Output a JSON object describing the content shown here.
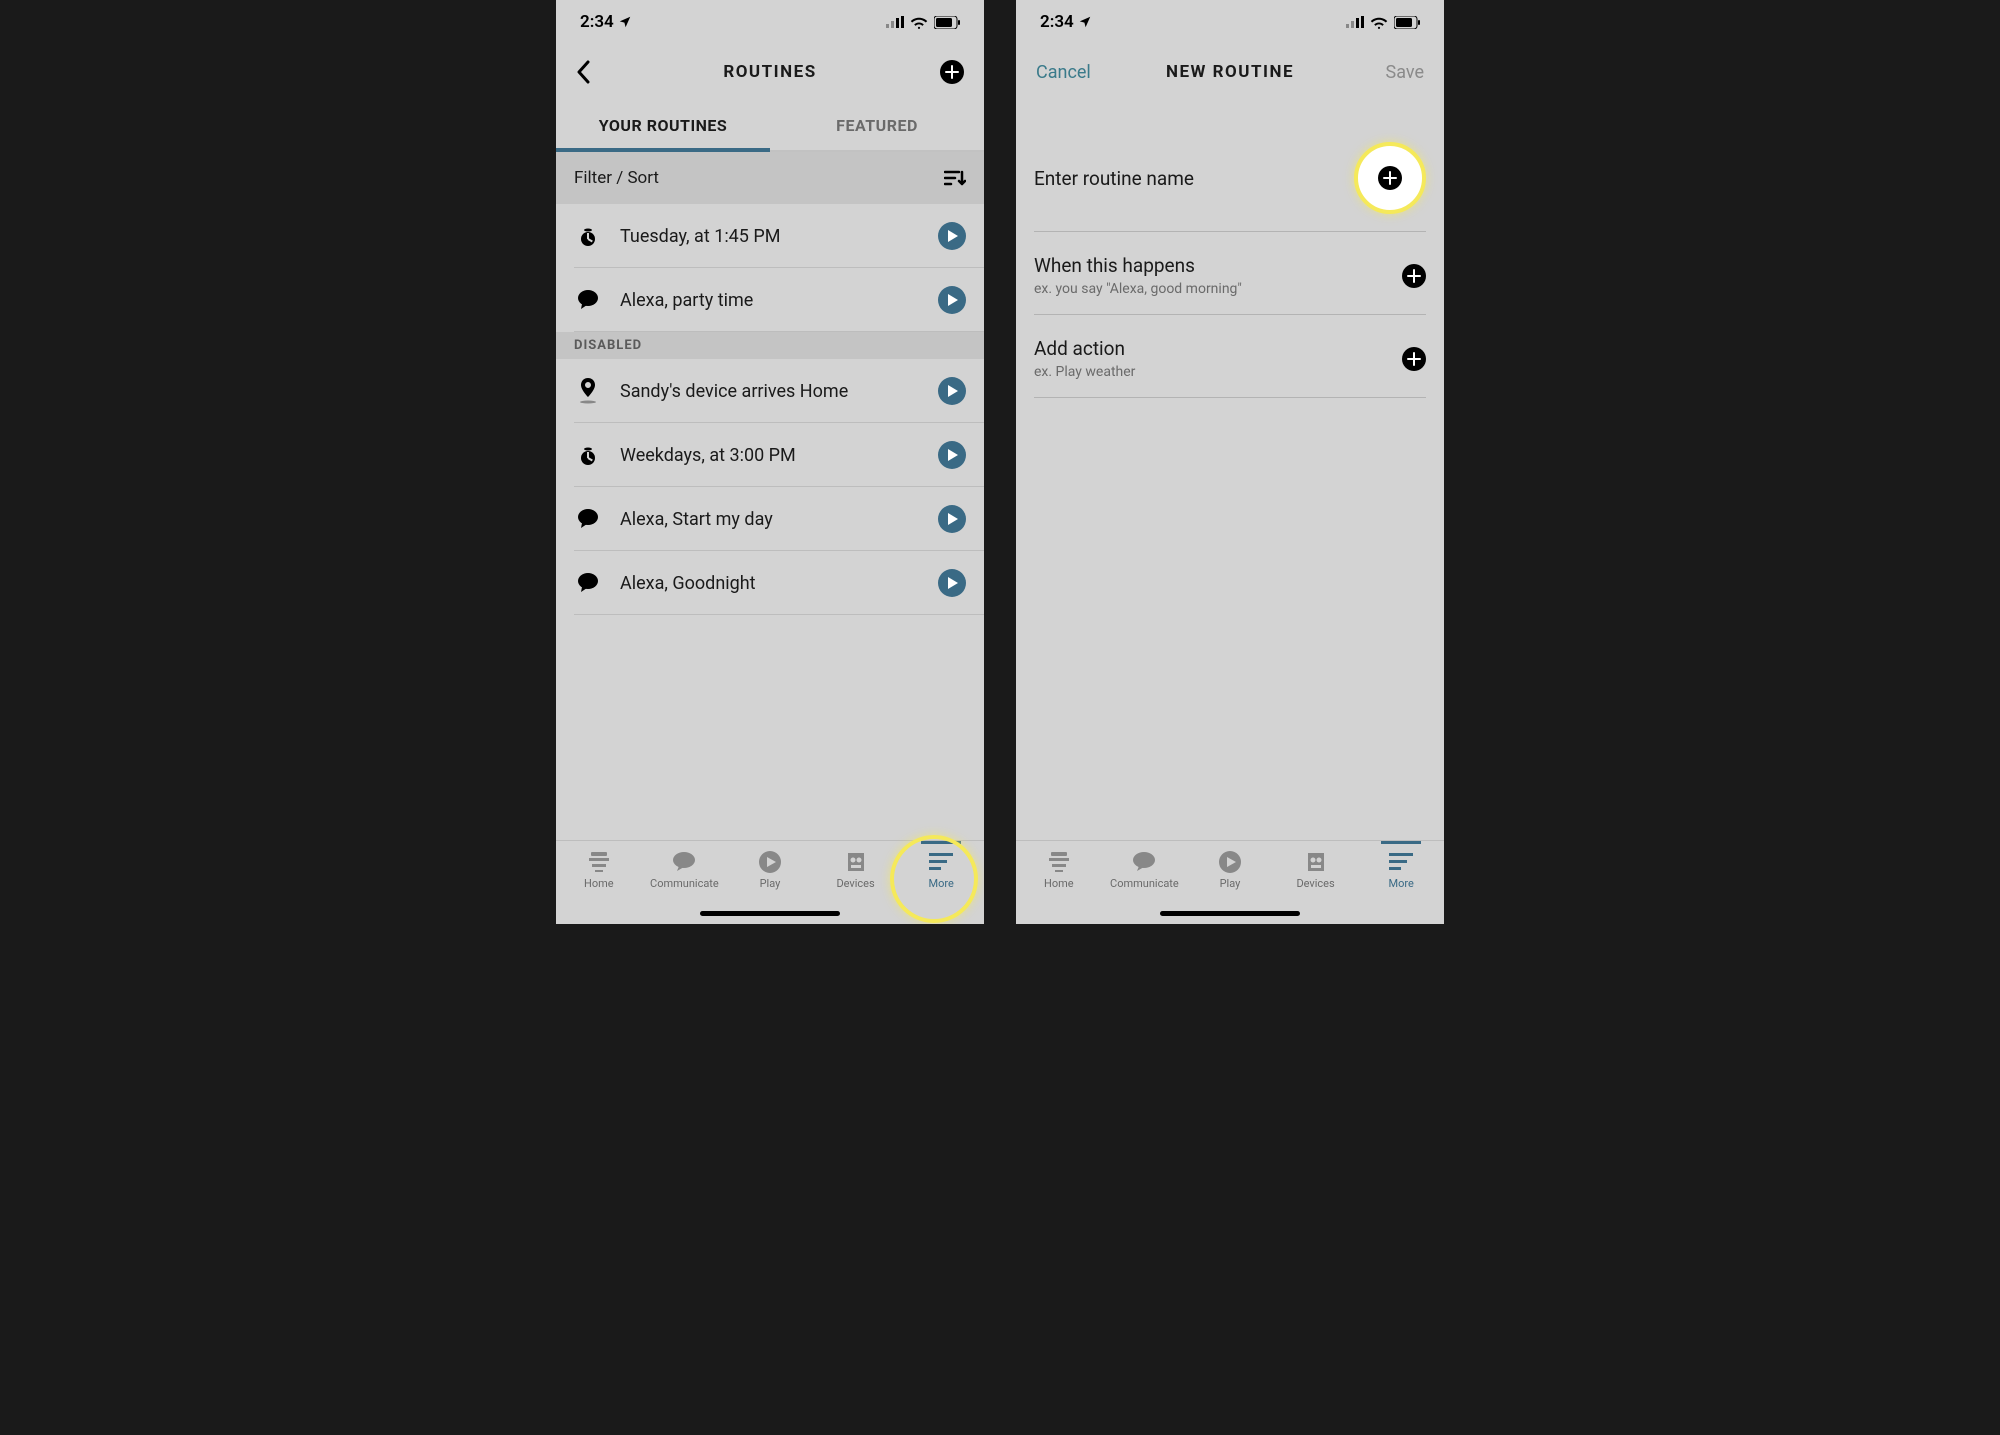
{
  "status": {
    "time": "2:34"
  },
  "left_screen": {
    "nav_title": "ROUTINES",
    "tabs": {
      "your": "YOUR ROUTINES",
      "featured": "FEATURED"
    },
    "filter": "Filter / Sort",
    "routines_active": [
      {
        "icon": "alarm",
        "label": "Tuesday, at 1:45 PM"
      },
      {
        "icon": "speech",
        "label": "Alexa, party time"
      }
    ],
    "disabled_header": "DISABLED",
    "routines_disabled": [
      {
        "icon": "pin",
        "label": "Sandy's device arrives Home"
      },
      {
        "icon": "alarm",
        "label": "Weekdays, at 3:00 PM"
      },
      {
        "icon": "speech",
        "label": "Alexa, Start my day"
      },
      {
        "icon": "speech",
        "label": "Alexa, Goodnight"
      }
    ]
  },
  "right_screen": {
    "cancel": "Cancel",
    "nav_title": "NEW ROUTINE",
    "save": "Save",
    "rows": {
      "name": "Enter routine name",
      "trigger_title": "When this happens",
      "trigger_sub": "ex. you say \"Alexa, good morning\"",
      "action_title": "Add action",
      "action_sub": "ex. Play weather"
    }
  },
  "tabbar": {
    "home": "Home",
    "communicate": "Communicate",
    "play": "Play",
    "devices": "Devices",
    "more": "More"
  }
}
